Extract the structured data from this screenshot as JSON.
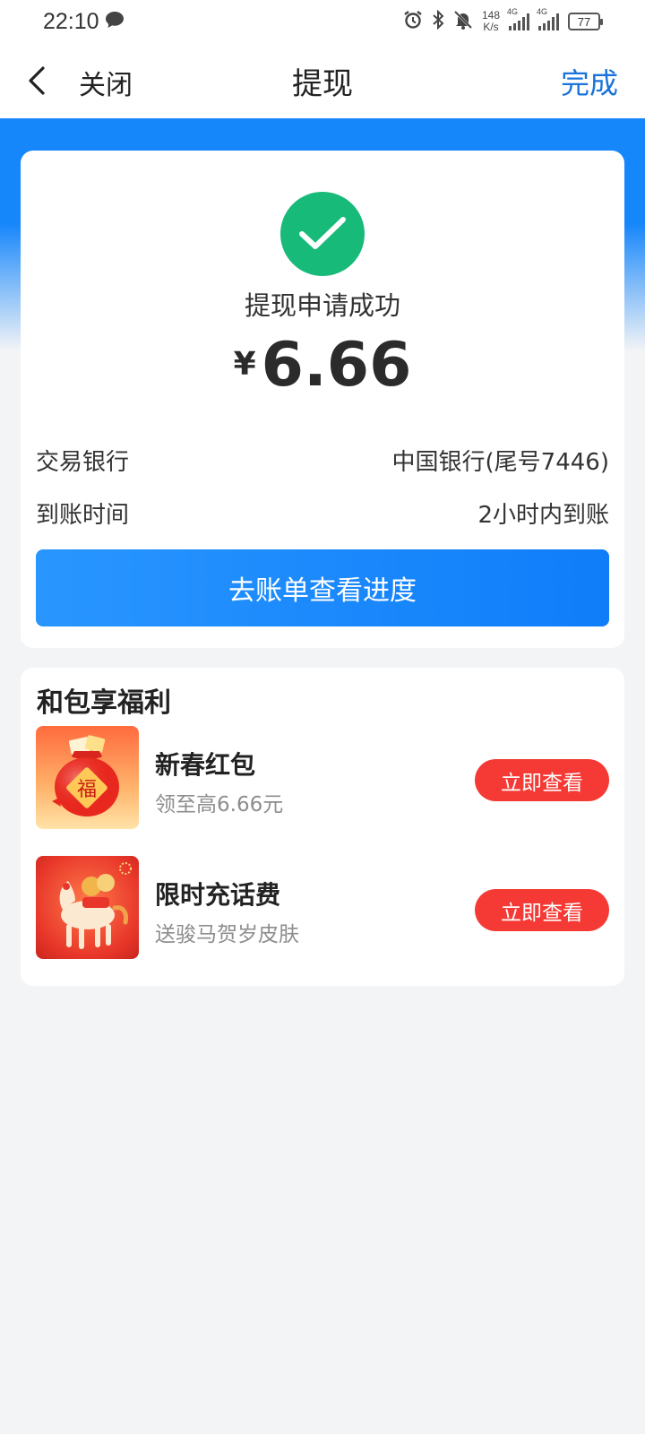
{
  "status_bar": {
    "time": "22:10",
    "net_speed_value": "148",
    "net_speed_unit": "K/s",
    "sim1_tag": "4G",
    "sim2_tag": "4G",
    "battery": "77"
  },
  "nav": {
    "close_label": "关闭",
    "title": "提现",
    "done_label": "完成"
  },
  "result": {
    "title": "提现申请成功",
    "currency": "¥",
    "amount": "6.66",
    "bank_label": "交易银行",
    "bank_value": "中国银行(尾号7446)",
    "arrival_label": "到账时间",
    "arrival_value": "2小时内到账",
    "progress_button": "去账单查看进度"
  },
  "benefits": {
    "title": "和包享福利",
    "items": [
      {
        "name": "新春红包",
        "desc": "领至高6.66元",
        "button": "立即查看",
        "thumb_text": "福"
      },
      {
        "name": "限时充话费",
        "desc": "送骏马贺岁皮肤",
        "button": "立即查看"
      }
    ]
  },
  "colors": {
    "brand_blue": "#1686fb",
    "success_green": "#17ba78",
    "cta_red": "#f53a35",
    "link_blue": "#1a73d9"
  }
}
